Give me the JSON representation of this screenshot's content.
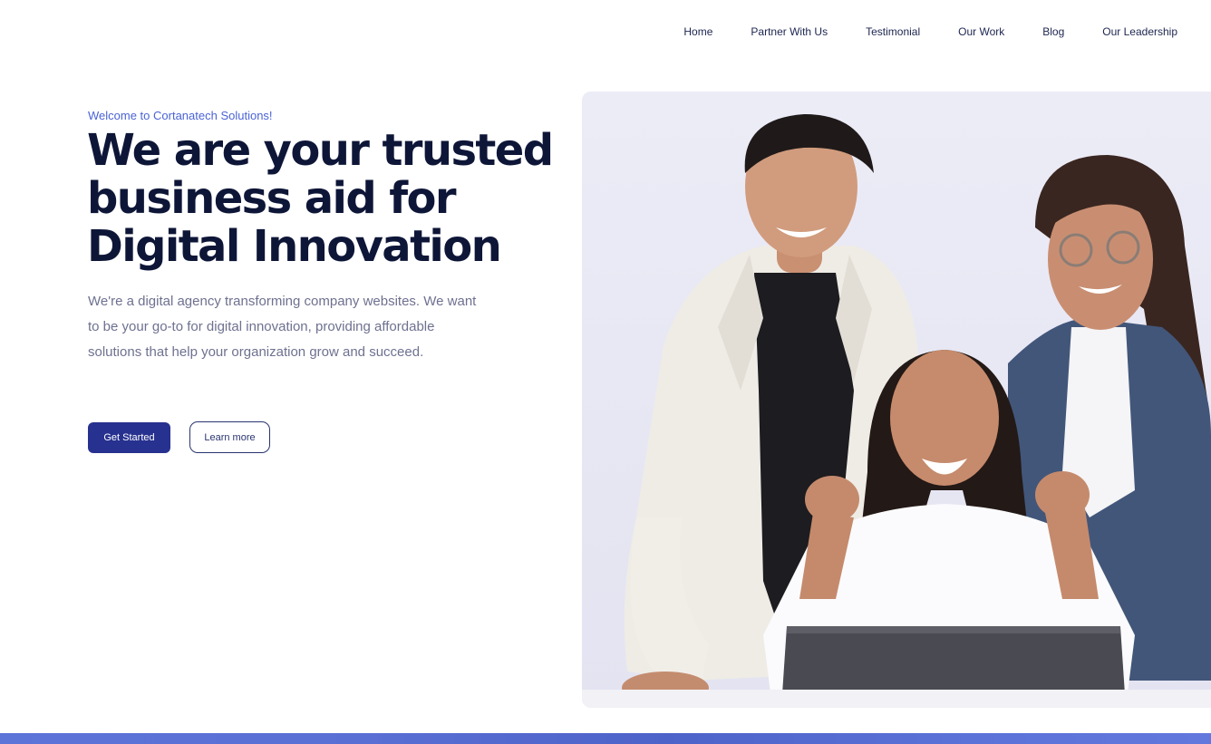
{
  "nav": {
    "items": [
      "Home",
      "Partner With Us",
      "Testimonial",
      "Our Work",
      "Blog",
      "Our Leadership"
    ]
  },
  "hero": {
    "eyebrow": "Welcome to Cortanatech Solutions!",
    "headline_lines": [
      "We are your trusted",
      "business aid for",
      "Digital Innovation"
    ],
    "description": "We're a digital agency transforming company websites. We want to be your go-to for digital innovation, providing affordable solutions that help your organization grow and succeed.",
    "primary_button": "Get Started",
    "secondary_button": "Learn more"
  },
  "colors": {
    "accent": "#27318f",
    "eyebrow": "#4a63d6",
    "heading": "#0e1638",
    "body_text": "#6e7190",
    "band": "#5a6fd4"
  }
}
